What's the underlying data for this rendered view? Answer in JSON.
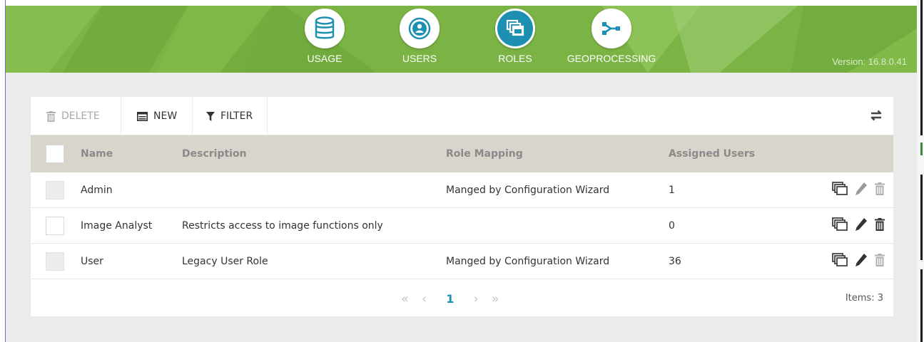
{
  "header": {
    "nav": [
      {
        "id": "usage",
        "label": "USAGE",
        "icon": "database-icon",
        "active": false
      },
      {
        "id": "users",
        "label": "USERS",
        "icon": "user-icon",
        "active": false
      },
      {
        "id": "roles",
        "label": "ROLES",
        "icon": "windows-icon",
        "active": true
      },
      {
        "id": "geoprocessing",
        "label": "GEOPROCESSING",
        "icon": "geoprocessing-icon",
        "active": false
      }
    ],
    "version": "Version: 16.8.0.41"
  },
  "toolbar": {
    "delete_label": "DELETE",
    "new_label": "NEW",
    "filter_label": "FILTER"
  },
  "table": {
    "columns": {
      "name": "Name",
      "description": "Description",
      "role_mapping": "Role Mapping",
      "assigned_users": "Assigned Users"
    },
    "rows": [
      {
        "name": "Admin",
        "description": "",
        "role_mapping": "Manged by Configuration Wizard",
        "assigned_users": "1",
        "locked": true
      },
      {
        "name": "Image Analyst",
        "description": "Restricts access to image functions only",
        "role_mapping": "",
        "assigned_users": "0",
        "locked": false
      },
      {
        "name": "User",
        "description": "Legacy User Role",
        "role_mapping": "Manged by Configuration Wizard",
        "assigned_users": "36",
        "locked": true
      }
    ]
  },
  "pagination": {
    "first": "«",
    "prev": "‹",
    "current_page": "1",
    "next": "›",
    "last": "»",
    "items_label": "Items: 3"
  },
  "colors": {
    "header_green": "#7bb344",
    "accent_blue": "#1d8fb0",
    "table_header_bg": "#d9d4cc"
  }
}
